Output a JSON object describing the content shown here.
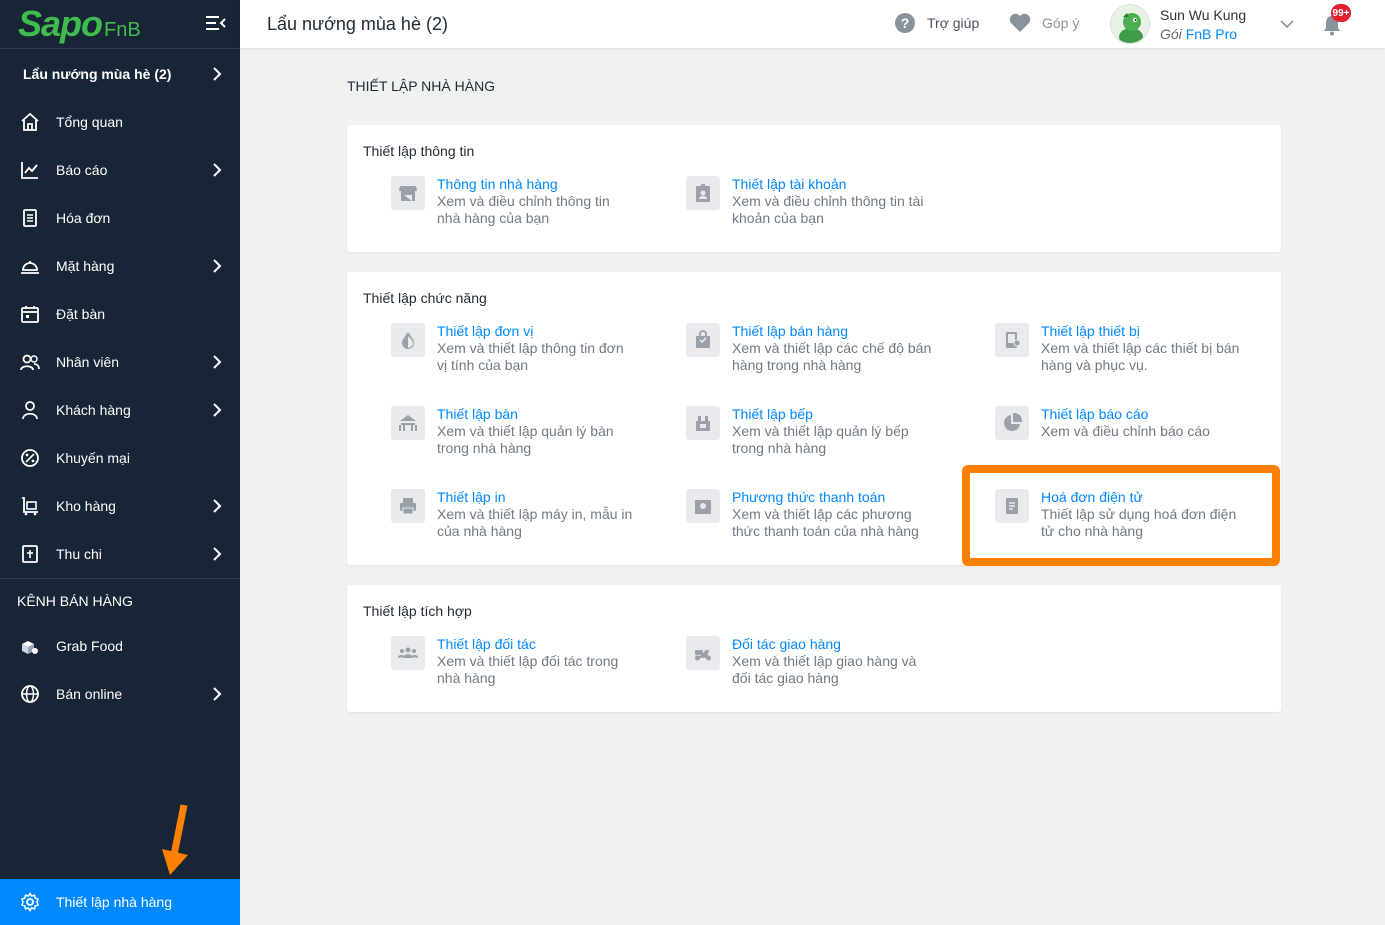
{
  "brand": {
    "logo": "Sapo",
    "logo_suffix": "FnB"
  },
  "header": {
    "title": "Lẩu nướng mùa hè (2)",
    "help": "Trợ giúp",
    "feedback": "Góp ý",
    "user_name": "Sun Wu Kung",
    "plan_prefix": "Gói",
    "plan_name": "FnB Pro",
    "notifications": "99+"
  },
  "sidebar": {
    "store": "Lẩu nướng mùa hè (2)",
    "items": [
      {
        "label": "Tổng quan",
        "icon": "home-icon"
      },
      {
        "label": "Báo cáo",
        "icon": "chart-icon"
      },
      {
        "label": "Hóa đơn",
        "icon": "invoice-icon"
      },
      {
        "label": "Mặt hàng",
        "icon": "dish-icon"
      },
      {
        "label": "Đặt bàn",
        "icon": "calendar-icon"
      },
      {
        "label": "Nhân viên",
        "icon": "staff-icon"
      },
      {
        "label": "Khách hàng",
        "icon": "customer-icon"
      },
      {
        "label": "Khuyến mại",
        "icon": "promo-icon"
      },
      {
        "label": "Kho hàng",
        "icon": "warehouse-icon"
      },
      {
        "label": "Thu chi",
        "icon": "cashbook-icon"
      }
    ],
    "channel_title": "KÊNH BÁN HÀNG",
    "channels": [
      {
        "label": "Grab Food",
        "icon": "grabfood-icon"
      },
      {
        "label": "Bán online",
        "icon": "globe-icon"
      }
    ],
    "active": "Thiết lập nhà hàng"
  },
  "content": {
    "section_title": "THIẾT LẬP NHÀ HÀNG",
    "info": {
      "title": "Thiết lập thông tin",
      "items": [
        {
          "title": "Thông tin nhà hàng",
          "desc": "Xem và điều chỉnh thông tin nhà hàng của bạn"
        },
        {
          "title": "Thiết lập tài khoản",
          "desc": "Xem và điều chỉnh thông tin tài khoản của bạn"
        }
      ]
    },
    "func": {
      "title": "Thiết lập chức năng",
      "items": [
        {
          "title": "Thiết lập đơn vị",
          "desc": "Xem và thiết lập thông tin đơn vị tính của bạn"
        },
        {
          "title": "Thiết lập bán hàng",
          "desc": "Xem và thiết lập các chế độ bán hàng trong nhà hàng"
        },
        {
          "title": "Thiết lập thiết bị",
          "desc": "Xem và thiết lập các thiết bị bán hàng và phục vụ."
        },
        {
          "title": "Thiết lập bàn",
          "desc": "Xem và thiết lập quản lý bàn trong nhà hàng"
        },
        {
          "title": "Thiết lập bếp",
          "desc": "Xem và thiết lập quản lý bếp trong nhà hàng"
        },
        {
          "title": "Thiết lập báo cáo",
          "desc": "Xem và điều chỉnh báo cáo"
        },
        {
          "title": "Thiết lập in",
          "desc": "Xem và thiết lập máy in, mẫu in của nhà hàng"
        },
        {
          "title": "Phương thức thanh toán",
          "desc": "Xem và thiết lập các phương thức thanh toán của nhà hàng"
        },
        {
          "title": "Hoá đơn điện tử",
          "desc": "Thiết lập sử dụng hoá đơn điện tử cho nhà hàng"
        }
      ]
    },
    "integration": {
      "title": "Thiết lập tích hợp",
      "items": [
        {
          "title": "Thiết lập đối tác",
          "desc": "Xem và thiết lập đối tác trong nhà hàng"
        },
        {
          "title": "Đối tác giao hàng",
          "desc": "Xem và thiết lập giao hàng và đối tác giao hàng"
        }
      ]
    }
  },
  "colors": {
    "sidebar": "#182537",
    "accent": "#0088ff",
    "brand_green": "#3fbb4f",
    "highlight": "#ff8000"
  }
}
